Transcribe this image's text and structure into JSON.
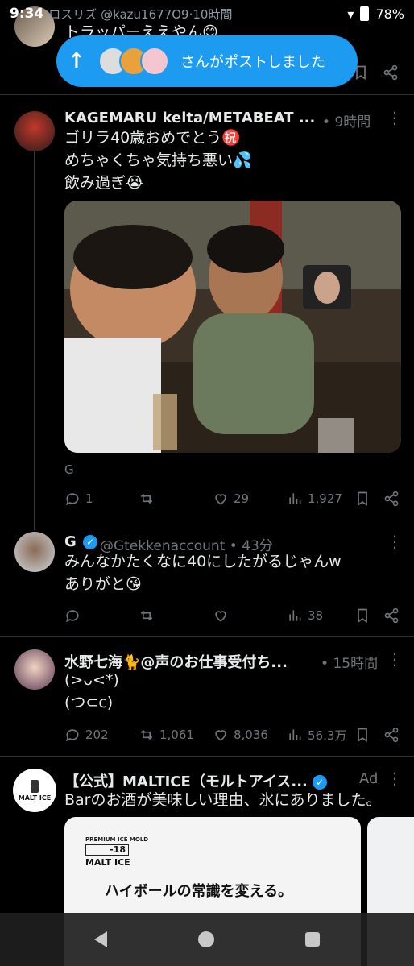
{
  "status_bar": {
    "time": "9:34",
    "background_text": "ロスリズ @kazu1677O9·10時間",
    "battery": "78%"
  },
  "toast": {
    "label": "さんがポストしました"
  },
  "partial_tweet": {
    "text": "トラッパーええやん😊"
  },
  "tweets": [
    {
      "name": "KAGEMARU keita/METABEAT ...",
      "time": "9時間",
      "lines": [
        "ゴリラ40歳おめでとう㊗️",
        "めちゃくちゃ気持ち悪い💦",
        "飲み過ぎ😭"
      ],
      "media_caption": "G",
      "replies": "1",
      "retweets": "",
      "likes": "29",
      "views": "1,927"
    },
    {
      "name": "G",
      "handle": "@Gtekkenaccount",
      "time": "43分",
      "lines": [
        "みんなかたくなに40にしたがるじゃんw",
        "ありがと😘"
      ],
      "replies": "",
      "retweets": "",
      "likes": "",
      "views": "38"
    },
    {
      "name": "水野七海🐈@声のお仕事受付ち...",
      "time": "15時間",
      "lines": [
        "(>ᴗ<*)",
        "(つ⊂c)"
      ],
      "replies": "202",
      "retweets": "1,061",
      "likes": "8,036",
      "views": "56.3万"
    },
    {
      "name": "【公式】MALTICE（モルトアイス...",
      "ad_label": "Ad",
      "lines": [
        "Barのお酒が美味しい理由、氷にありました。"
      ],
      "card_brand_top": "PREMIUM ICE MOLD",
      "card_temp": "-18",
      "card_brand": "MALT ICE",
      "card_headline": "ハイボールの常識を変える。",
      "avatar_text": "MALT ICE"
    }
  ],
  "colors": {
    "accent": "#1d9bf0",
    "verified": "#1d9bf0",
    "muted": "#71767b",
    "text": "#e7e9ea",
    "divider": "#2f3336"
  },
  "icons": [
    "reply-icon",
    "retweet-icon",
    "like-icon",
    "views-icon",
    "bookmark-icon",
    "share-icon",
    "more-icon",
    "verified-icon",
    "arrow-up-icon"
  ]
}
